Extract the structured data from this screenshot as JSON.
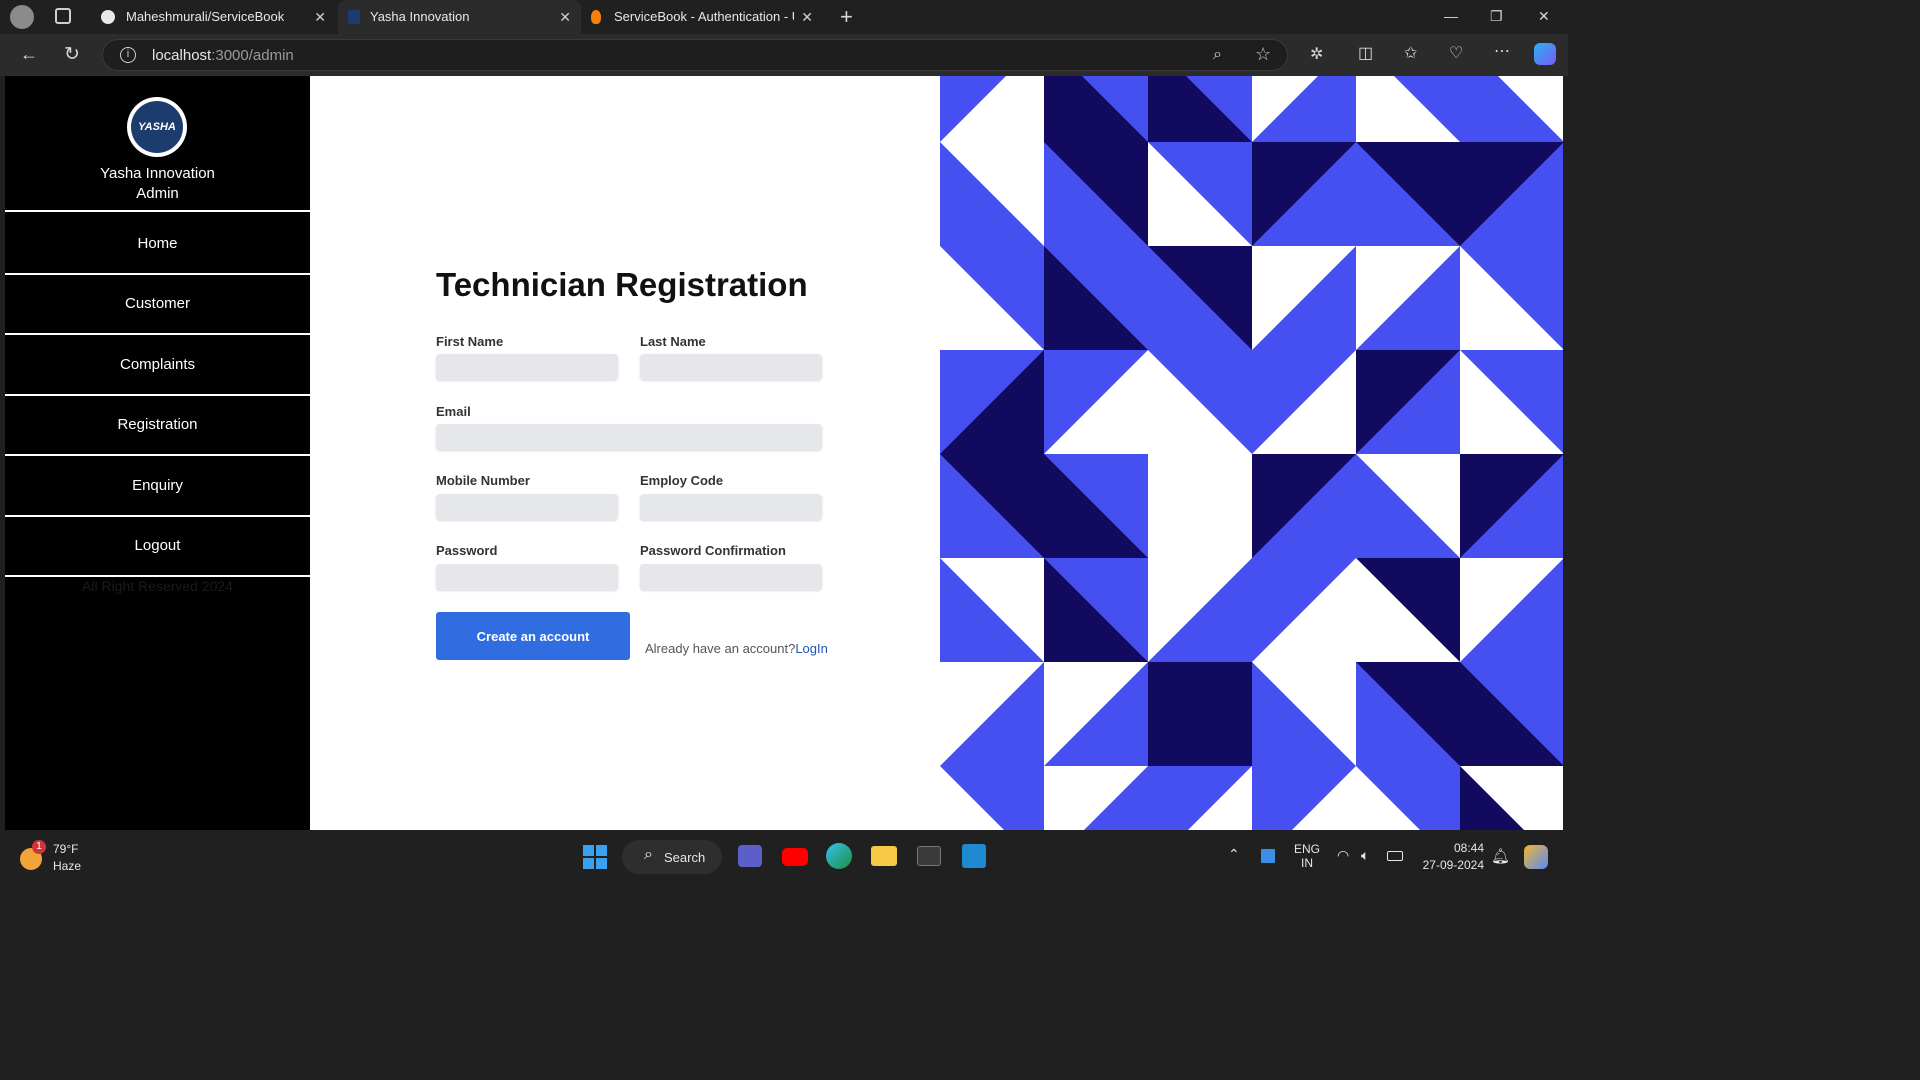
{
  "browser": {
    "tabs": [
      {
        "title": "Maheshmurali/ServiceBook",
        "icon": "github-icon",
        "active": false
      },
      {
        "title": "Yasha Innovation",
        "icon": "site-favicon",
        "active": true
      },
      {
        "title": "ServiceBook - Authentication - Us",
        "icon": "firebase-icon",
        "active": false
      }
    ],
    "url_host": "localhost",
    "url_path": ":3000/admin"
  },
  "sidebar": {
    "logo_text": "YASHA",
    "brand_line1": "Yasha Innovation",
    "brand_line2": "Admin",
    "items": [
      {
        "label": "Home"
      },
      {
        "label": "Customer"
      },
      {
        "label": "Complaints"
      },
      {
        "label": "Registration"
      },
      {
        "label": "Enquiry"
      },
      {
        "label": "Logout"
      }
    ],
    "footer": "All Right Reserved 2024"
  },
  "form": {
    "title": "Technician Registration",
    "first_name_label": "First Name",
    "last_name_label": "Last Name",
    "email_label": "Email",
    "mobile_label": "Mobile Number",
    "employ_code_label": "Employ Code",
    "password_label": "Password",
    "password_confirm_label": "Password Confirmation",
    "submit_label": "Create an account",
    "already_text": "Already have an account?",
    "login_link": "LogIn"
  },
  "pattern_colors": {
    "light": "#4650f0",
    "dark": "#120a5e",
    "white": "#ffffff"
  },
  "taskbar": {
    "weather_temp": "79°F",
    "weather_desc": "Haze",
    "weather_badge": "1",
    "search_label": "Search",
    "lang_line1": "ENG",
    "lang_line2": "IN",
    "time": "08:44",
    "date": "27-09-2024"
  }
}
